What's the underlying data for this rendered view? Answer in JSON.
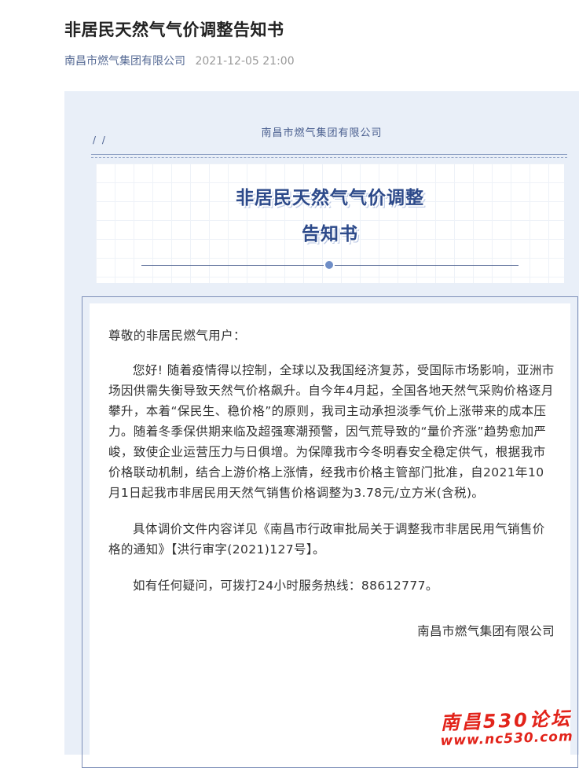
{
  "article": {
    "title": "非居民天然气气价调整告知书",
    "author": "南昌市燃气集团有限公司",
    "date": "2021-12-05 21:00"
  },
  "panel": {
    "org_name": "南昌市燃气集团有限公司",
    "slashes": "/ /",
    "banner_line1": "非居民天然气气价调整",
    "banner_line2": "告知书"
  },
  "notice": {
    "greeting": "尊敬的非居民燃气用户：",
    "paragraph1": "您好! 随着疫情得以控制，全球以及我国经济复苏，受国际市场影响，亚洲市场因供需失衡导致天然气价格飙升。自今年4月起，全国各地天然气采购价格逐月攀升，本着“保民生、稳价格”的原则，我司主动承担淡季气价上涨带来的成本压力。随着冬季保供期来临及超强寒潮预警，因气荒导致的“量价齐涨”趋势愈加严峻，致使企业运营压力与日俱增。为保障我市今冬明春安全稳定供气，根据我市价格联动机制，结合上游价格上涨情，经我市价格主管部门批准，自2021年10月1日起我市非居民用天然气销售价格调整为3.78元/立方米(含税)。",
    "paragraph2": "具体调价文件内容详见《南昌市行政审批局关于调整我市非居民用气销售价格的通知》【洪行审字(2021)127号】。",
    "paragraph3": "如有任何疑问，可拨打24小时服务热线：88612777。",
    "signature": "南昌市燃气集团有限公司"
  },
  "watermark": {
    "line1": "南昌530论坛",
    "line2": "www.nc530.com"
  },
  "colors": {
    "panel_bg": "#e9eff8",
    "accent_blue": "#2d4a8a",
    "link_blue": "#576b95",
    "watermark_red": "#e2231a"
  }
}
